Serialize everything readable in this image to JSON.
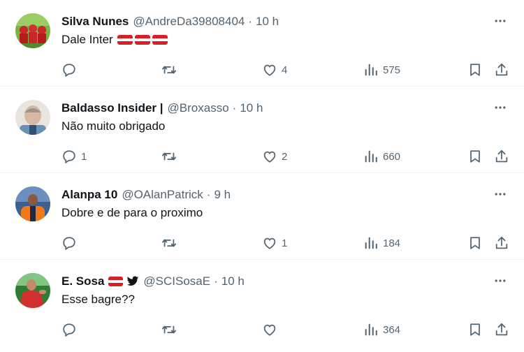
{
  "tweets": [
    {
      "name": "Silva Nunes",
      "handle": "@AndreDa39808404",
      "separator": "·",
      "time": "10 h",
      "text": "Dale Inter",
      "text_flags": 3,
      "reply_count": "",
      "like_count": "4",
      "views": "575",
      "avatar_colors": [
        "#c62828",
        "#8bc34a"
      ]
    },
    {
      "name": "Baldasso Insider |",
      "handle": "@Broxasso",
      "separator": "·",
      "time": "10 h",
      "text": "Não muito obrigado",
      "reply_count": "1",
      "like_count": "2",
      "views": "660",
      "avatar_colors": [
        "#d7c3b3",
        "#5b7fa6"
      ]
    },
    {
      "name": "Alanpa 10",
      "handle": "@OAlanPatrick",
      "separator": "·",
      "time": "9 h",
      "text": "Dobre e de para o proximo",
      "reply_count": "",
      "like_count": "1",
      "views": "184",
      "avatar_colors": [
        "#f07a1a",
        "#4a6da7"
      ]
    },
    {
      "name": "E. Sosa",
      "handle": "@SCISosaE",
      "separator": "·",
      "time": "10 h",
      "text": "Esse bagre??",
      "reply_count": "",
      "like_count": "",
      "views": "364",
      "avatar_colors": [
        "#d32f2f",
        "#2e7d32"
      ]
    }
  ],
  "icons": {
    "reply": "reply-icon",
    "retweet": "retweet-icon",
    "like": "like-icon",
    "views": "views-icon",
    "bookmark": "bookmark-icon",
    "share": "share-icon",
    "more": "more-icon",
    "bird": "twitter-bird-icon",
    "flag": "internacional-flag-icon"
  },
  "colors": {
    "text": "#0f1419",
    "secondary": "#536471",
    "divider": "#eff3f4",
    "flag_red": "#d81f26",
    "bird_black": "#0f1419"
  }
}
